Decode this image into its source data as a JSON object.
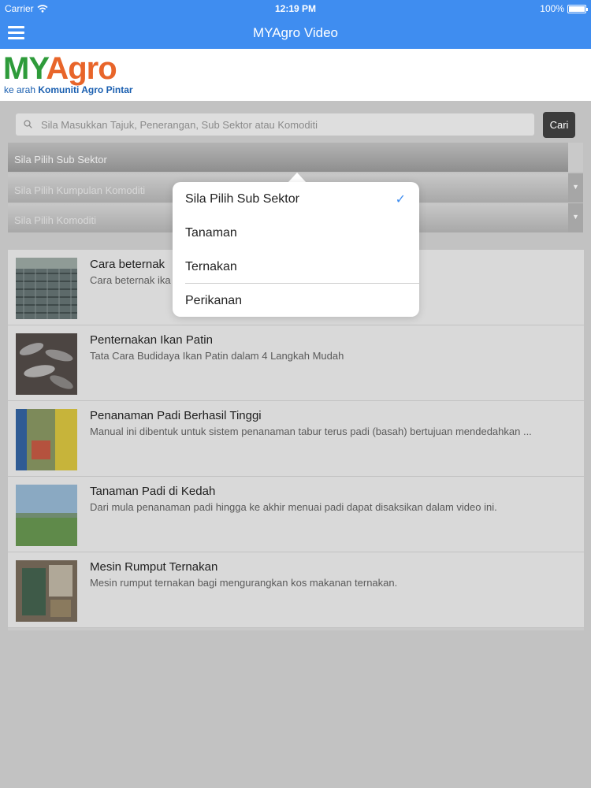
{
  "status_bar": {
    "carrier": "Carrier",
    "time": "12:19 PM",
    "battery": "100%"
  },
  "nav": {
    "title": "MYAgro Video"
  },
  "logo": {
    "my": "MY",
    "agro": "Agro",
    "tagline_prefix": "ke arah ",
    "tagline_bold": "Komuniti Agro Pintar"
  },
  "search": {
    "placeholder": "Sila Masukkan Tajuk, Penerangan, Sub Sektor atau Komoditi",
    "button": "Cari"
  },
  "selectors": {
    "sub_sektor": "Sila Pilih Sub Sektor",
    "kumpulan_komoditi": "Sila Pilih Kumpulan Komoditi",
    "komoditi": "Sila Pilih Komoditi"
  },
  "popover": {
    "options": [
      {
        "label": "Sila Pilih Sub Sektor",
        "selected": true
      },
      {
        "label": "Tanaman",
        "selected": false
      },
      {
        "label": "Ternakan",
        "selected": false
      },
      {
        "label": "Perikanan",
        "selected": false
      }
    ],
    "check_mark": "✓"
  },
  "videos": [
    {
      "title": "Cara beternak",
      "desc": "Cara beternak ika                                                                          aksudnya adalah, bahwa pem..."
    },
    {
      "title": "Penternakan Ikan Patin",
      "desc": "Tata Cara Budidaya Ikan Patin dalam 4 Langkah Mudah"
    },
    {
      "title": "Penanaman Padi Berhasil Tinggi",
      "desc": "Manual ini dibentuk untuk sistem penanaman tabur terus padi (basah) bertujuan mendedahkan ..."
    },
    {
      "title": "Tanaman Padi di Kedah",
      "desc": "Dari mula penanaman padi hingga ke akhir menuai padi dapat disaksikan dalam video ini."
    },
    {
      "title": "Mesin Rumput Ternakan",
      "desc": "Mesin rumput ternakan bagi mengurangkan kos makanan ternakan."
    }
  ],
  "colors": {
    "accent": "#3f8df0",
    "logo_green": "#2e9b3a",
    "logo_orange": "#e8652a"
  }
}
